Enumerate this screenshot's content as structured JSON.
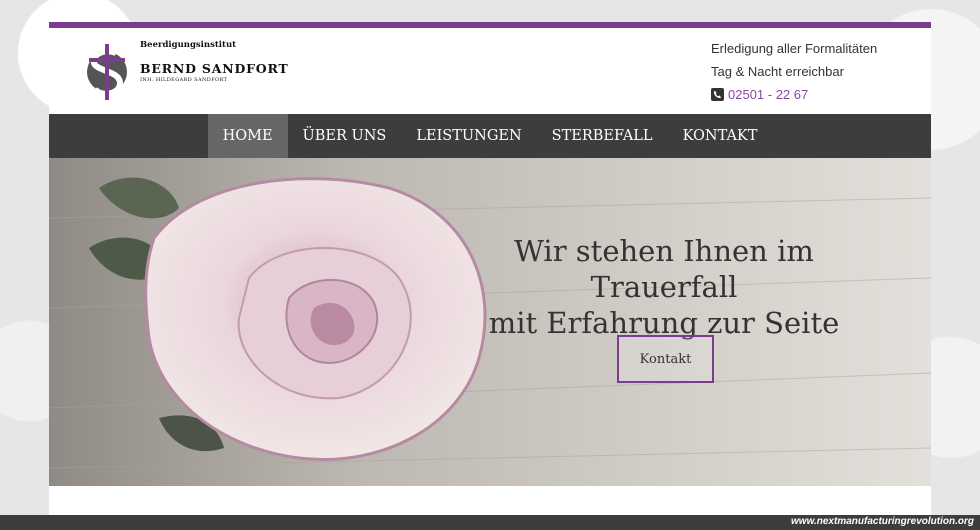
{
  "brand": {
    "line1": "Beerdigungsinstitut",
    "name": "BERND SANDFORT",
    "owner": "INH. HILDEGARD SANDFORT"
  },
  "header_contact": {
    "line1": "Erledigung aller Formalitäten",
    "line2": "Tag & Nacht erreichbar",
    "phone": "02501 - 22 67"
  },
  "nav": {
    "items": [
      {
        "label": "HOME"
      },
      {
        "label": "ÜBER UNS"
      },
      {
        "label": "LEISTUNGEN"
      },
      {
        "label": "STERBEFALL"
      },
      {
        "label": "KONTAKT"
      }
    ]
  },
  "hero": {
    "title_line1": "Wir stehen Ihnen im Trauerfall",
    "title_line2": "mit Erfahrung zur Seite",
    "button": "Kontakt"
  },
  "footer": {
    "watermark": "www.nextmanufacturingrevolution.org"
  },
  "colors": {
    "accent": "#7b3b8f",
    "nav_bg": "#3d3d3d",
    "nav_active": "#666666"
  }
}
